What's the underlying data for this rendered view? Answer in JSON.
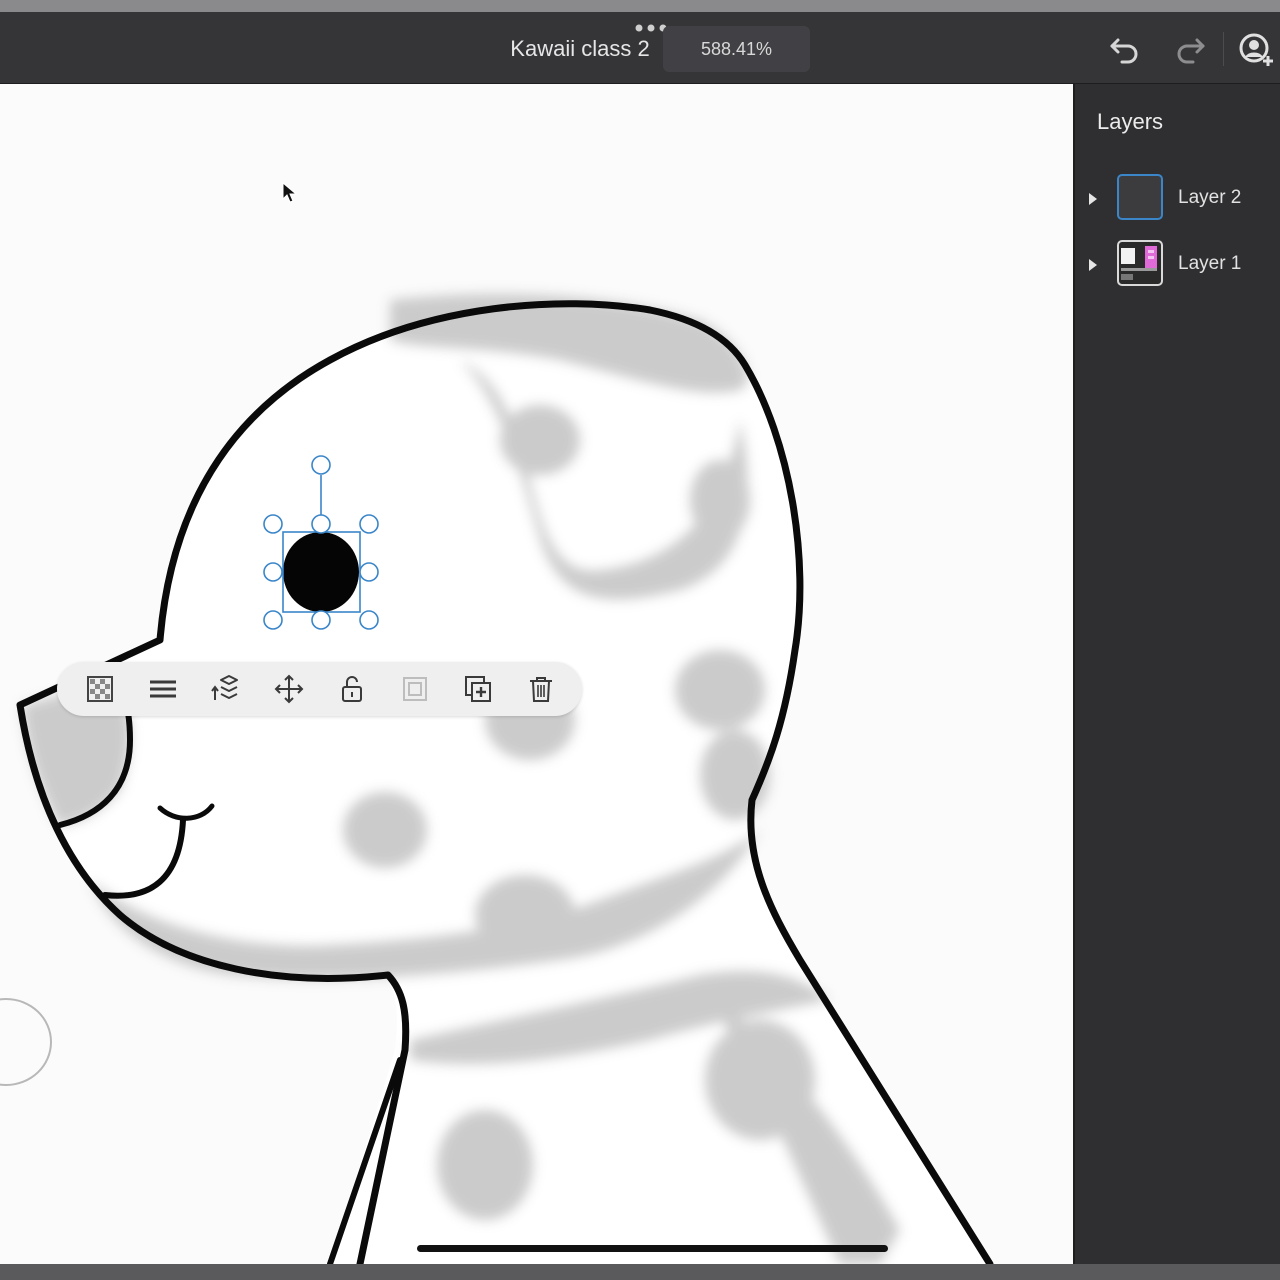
{
  "header": {
    "doc_title": "Kawaii class 2",
    "zoom": "588.41%",
    "icons": [
      "more-dots-icon",
      "undo-icon",
      "redo-icon",
      "invite-user-icon"
    ]
  },
  "layers_panel": {
    "title": "Layers",
    "layers": [
      {
        "name": "Layer 2",
        "selected": true
      },
      {
        "name": "Layer 1",
        "selected": false
      }
    ]
  },
  "context_toolbar": {
    "icons": [
      "transparency-icon",
      "menu-icon",
      "arrange-icon",
      "move-icon",
      "lock-icon",
      "mask-icon",
      "duplicate-icon",
      "delete-icon"
    ]
  },
  "colors": {
    "accent": "#3a86c8",
    "panel_bg": "#2f2e30",
    "topbar_bg": "#353437",
    "canvas_bg": "#fbfbfb",
    "fur_spots": "#c9c9c9"
  }
}
